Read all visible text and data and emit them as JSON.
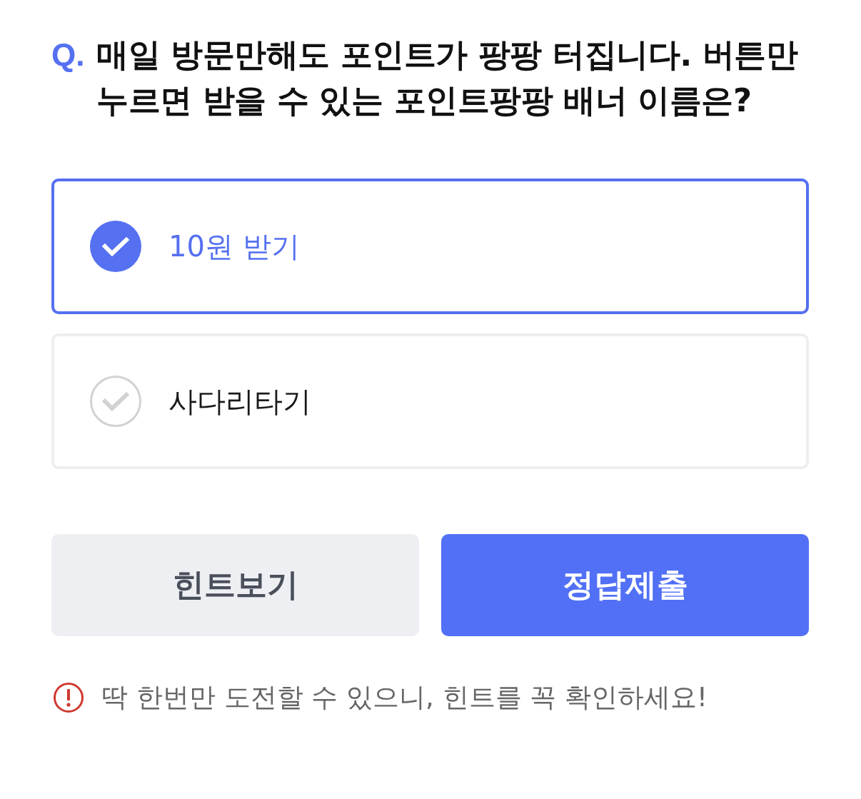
{
  "question": {
    "prefix": "Q.",
    "text": "매일 방문만해도 포인트가 팡팡 터집니다. 버튼만 누르면 받을 수 있는 포인트팡팡 배너 이름은?"
  },
  "options": [
    {
      "label": "10원 받기",
      "selected": true
    },
    {
      "label": "사다리타기",
      "selected": false
    }
  ],
  "buttons": [
    {
      "kind": "secondary",
      "label": "힌트보기"
    },
    {
      "kind": "primary",
      "label": "정답제출"
    }
  ],
  "notice": {
    "text": "딱 한번만 도전할 수 있으니, 힌트를 꼭 확인하세요!"
  }
}
